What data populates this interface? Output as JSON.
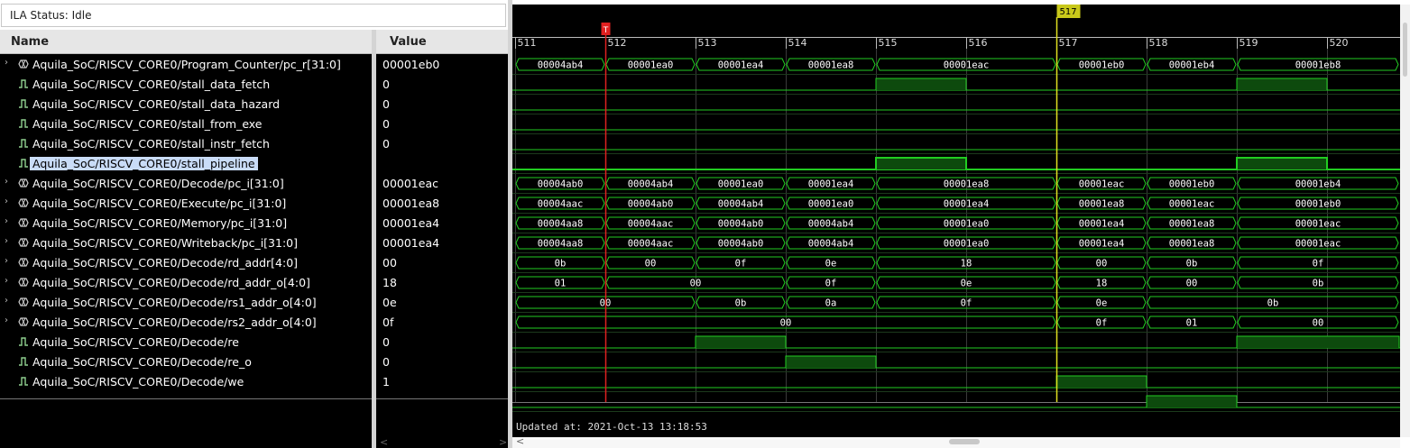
{
  "status": {
    "label": "ILA Status: Idle"
  },
  "columns": {
    "name": "Name",
    "value": "Value"
  },
  "signals": [
    {
      "name": "Aquila_SoC/RISCV_CORE0/Program_Counter/pc_r[31:0]",
      "value": "00001eb0",
      "type": "bus",
      "expandable": true,
      "icon": "bus-icon"
    },
    {
      "name": "Aquila_SoC/RISCV_CORE0/stall_data_fetch",
      "value": "0",
      "type": "bit",
      "expandable": false,
      "icon": "bit-icon"
    },
    {
      "name": "Aquila_SoC/RISCV_CORE0/stall_data_hazard",
      "value": "0",
      "type": "bit",
      "expandable": false,
      "icon": "bit-icon"
    },
    {
      "name": "Aquila_SoC/RISCV_CORE0/stall_from_exe",
      "value": "0",
      "type": "bit",
      "expandable": false,
      "icon": "bit-icon"
    },
    {
      "name": "Aquila_SoC/RISCV_CORE0/stall_instr_fetch",
      "value": "0",
      "type": "bit",
      "expandable": false,
      "icon": "bit-icon"
    },
    {
      "name": "Aquila_SoC/RISCV_CORE0/stall_pipeline",
      "value": "0",
      "type": "bit",
      "expandable": false,
      "icon": "bit-icon",
      "selected": true
    },
    {
      "name": "Aquila_SoC/RISCV_CORE0/Decode/pc_i[31:0]",
      "value": "00001eac",
      "type": "bus",
      "expandable": true,
      "icon": "bus-icon"
    },
    {
      "name": "Aquila_SoC/RISCV_CORE0/Execute/pc_i[31:0]",
      "value": "00001ea8",
      "type": "bus",
      "expandable": true,
      "icon": "bus-icon"
    },
    {
      "name": "Aquila_SoC/RISCV_CORE0/Memory/pc_i[31:0]",
      "value": "00001ea4",
      "type": "bus",
      "expandable": true,
      "icon": "bus-icon"
    },
    {
      "name": "Aquila_SoC/RISCV_CORE0/Writeback/pc_i[31:0]",
      "value": "00001ea4",
      "type": "bus",
      "expandable": true,
      "icon": "bus-icon"
    },
    {
      "name": "Aquila_SoC/RISCV_CORE0/Decode/rd_addr[4:0]",
      "value": "00",
      "type": "bus",
      "expandable": true,
      "icon": "bus-icon"
    },
    {
      "name": "Aquila_SoC/RISCV_CORE0/Decode/rd_addr_o[4:0]",
      "value": "18",
      "type": "bus",
      "expandable": true,
      "icon": "bus-icon"
    },
    {
      "name": "Aquila_SoC/RISCV_CORE0/Decode/rs1_addr_o[4:0]",
      "value": "0e",
      "type": "bus",
      "expandable": true,
      "icon": "bus-icon"
    },
    {
      "name": "Aquila_SoC/RISCV_CORE0/Decode/rs2_addr_o[4:0]",
      "value": "0f",
      "type": "bus",
      "expandable": true,
      "icon": "bus-icon"
    },
    {
      "name": "Aquila_SoC/RISCV_CORE0/Decode/re",
      "value": "0",
      "type": "bit",
      "expandable": false,
      "icon": "bit-icon"
    },
    {
      "name": "Aquila_SoC/RISCV_CORE0/Decode/re_o",
      "value": "0",
      "type": "bit",
      "expandable": false,
      "icon": "bit-icon"
    },
    {
      "name": "Aquila_SoC/RISCV_CORE0/Decode/we",
      "value": "1",
      "type": "bit",
      "expandable": false,
      "icon": "bit-icon"
    }
  ],
  "waveform": {
    "samples": [
      511,
      512,
      513,
      514,
      515,
      516,
      517,
      518,
      519,
      520
    ],
    "cursor_marker": {
      "label": "T",
      "sample": 512,
      "color": "#e02020"
    },
    "cursor_current": {
      "label": "517",
      "sample": 517,
      "color": "#e0e020"
    },
    "trace_color": "#22cc22",
    "rows": [
      {
        "segments": [
          {
            "start": 511,
            "end": 512,
            "label": "00004ab4"
          },
          {
            "start": 512,
            "end": 513,
            "label": "00001ea0"
          },
          {
            "start": 513,
            "end": 514,
            "label": "00001ea4"
          },
          {
            "start": 514,
            "end": 515,
            "label": "00001ea8"
          },
          {
            "start": 515,
            "end": 517,
            "label": "00001eac"
          },
          {
            "start": 517,
            "end": 518,
            "label": "00001eb0"
          },
          {
            "start": 518,
            "end": 519,
            "label": "00001eb4"
          },
          {
            "start": 519,
            "end": 520.8,
            "label": "00001eb8"
          }
        ]
      },
      {
        "high": [
          [
            515,
            516
          ],
          [
            519,
            520
          ]
        ]
      },
      {
        "high": []
      },
      {
        "high": []
      },
      {
        "high": []
      },
      {
        "high": [
          [
            515,
            516
          ],
          [
            519,
            520
          ]
        ],
        "highlight": true
      },
      {
        "segments": [
          {
            "start": 511,
            "end": 512,
            "label": "00004ab0"
          },
          {
            "start": 512,
            "end": 513,
            "label": "00004ab4"
          },
          {
            "start": 513,
            "end": 514,
            "label": "00001ea0"
          },
          {
            "start": 514,
            "end": 515,
            "label": "00001ea4"
          },
          {
            "start": 515,
            "end": 517,
            "label": "00001ea8"
          },
          {
            "start": 517,
            "end": 518,
            "label": "00001eac"
          },
          {
            "start": 518,
            "end": 519,
            "label": "00001eb0"
          },
          {
            "start": 519,
            "end": 520.8,
            "label": "00001eb4"
          }
        ]
      },
      {
        "segments": [
          {
            "start": 511,
            "end": 512,
            "label": "00004aac"
          },
          {
            "start": 512,
            "end": 513,
            "label": "00004ab0"
          },
          {
            "start": 513,
            "end": 514,
            "label": "00004ab4"
          },
          {
            "start": 514,
            "end": 515,
            "label": "00001ea0"
          },
          {
            "start": 515,
            "end": 517,
            "label": "00001ea4"
          },
          {
            "start": 517,
            "end": 518,
            "label": "00001ea8"
          },
          {
            "start": 518,
            "end": 519,
            "label": "00001eac"
          },
          {
            "start": 519,
            "end": 520.8,
            "label": "00001eb0"
          }
        ]
      },
      {
        "segments": [
          {
            "start": 511,
            "end": 512,
            "label": "00004aa8"
          },
          {
            "start": 512,
            "end": 513,
            "label": "00004aac"
          },
          {
            "start": 513,
            "end": 514,
            "label": "00004ab0"
          },
          {
            "start": 514,
            "end": 515,
            "label": "00004ab4"
          },
          {
            "start": 515,
            "end": 517,
            "label": "00001ea0"
          },
          {
            "start": 517,
            "end": 518,
            "label": "00001ea4"
          },
          {
            "start": 518,
            "end": 519,
            "label": "00001ea8"
          },
          {
            "start": 519,
            "end": 520.8,
            "label": "00001eac"
          }
        ]
      },
      {
        "segments": [
          {
            "start": 511,
            "end": 512,
            "label": "00004aa8"
          },
          {
            "start": 512,
            "end": 513,
            "label": "00004aac"
          },
          {
            "start": 513,
            "end": 514,
            "label": "00004ab0"
          },
          {
            "start": 514,
            "end": 515,
            "label": "00004ab4"
          },
          {
            "start": 515,
            "end": 517,
            "label": "00001ea0"
          },
          {
            "start": 517,
            "end": 518,
            "label": "00001ea4"
          },
          {
            "start": 518,
            "end": 519,
            "label": "00001ea8"
          },
          {
            "start": 519,
            "end": 520.8,
            "label": "00001eac"
          }
        ]
      },
      {
        "segments": [
          {
            "start": 511,
            "end": 512,
            "label": "0b"
          },
          {
            "start": 512,
            "end": 513,
            "label": "00"
          },
          {
            "start": 513,
            "end": 514,
            "label": "0f"
          },
          {
            "start": 514,
            "end": 515,
            "label": "0e"
          },
          {
            "start": 515,
            "end": 517,
            "label": "18"
          },
          {
            "start": 517,
            "end": 518,
            "label": "00"
          },
          {
            "start": 518,
            "end": 519,
            "label": "0b"
          },
          {
            "start": 519,
            "end": 520.8,
            "label": "0f"
          }
        ]
      },
      {
        "segments": [
          {
            "start": 511,
            "end": 512,
            "label": "01"
          },
          {
            "start": 512,
            "end": 514,
            "label": "00"
          },
          {
            "start": 514,
            "end": 515,
            "label": "0f"
          },
          {
            "start": 515,
            "end": 517,
            "label": "0e"
          },
          {
            "start": 517,
            "end": 518,
            "label": "18"
          },
          {
            "start": 518,
            "end": 519,
            "label": "00"
          },
          {
            "start": 519,
            "end": 520.8,
            "label": "0b"
          }
        ]
      },
      {
        "segments": [
          {
            "start": 511,
            "end": 513,
            "label": "00"
          },
          {
            "start": 513,
            "end": 514,
            "label": "0b"
          },
          {
            "start": 514,
            "end": 515,
            "label": "0a"
          },
          {
            "start": 515,
            "end": 517,
            "label": "0f"
          },
          {
            "start": 517,
            "end": 518,
            "label": "0e"
          },
          {
            "start": 518,
            "end": 520.8,
            "label": "0b"
          }
        ]
      },
      {
        "segments": [
          {
            "start": 511,
            "end": 517,
            "label": "00"
          },
          {
            "start": 517,
            "end": 518,
            "label": "0f"
          },
          {
            "start": 518,
            "end": 519,
            "label": "01"
          },
          {
            "start": 519,
            "end": 520.8,
            "label": "00"
          }
        ]
      },
      {
        "high": [
          [
            513,
            514
          ],
          [
            519,
            520.8
          ]
        ]
      },
      {
        "high": [
          [
            514,
            515
          ]
        ]
      },
      {
        "high": [
          [
            517,
            518
          ]
        ]
      },
      {
        "high": [
          [
            518,
            519
          ]
        ]
      }
    ],
    "updated_text": "Updated at: 2021-Oct-13 13:18:53"
  }
}
